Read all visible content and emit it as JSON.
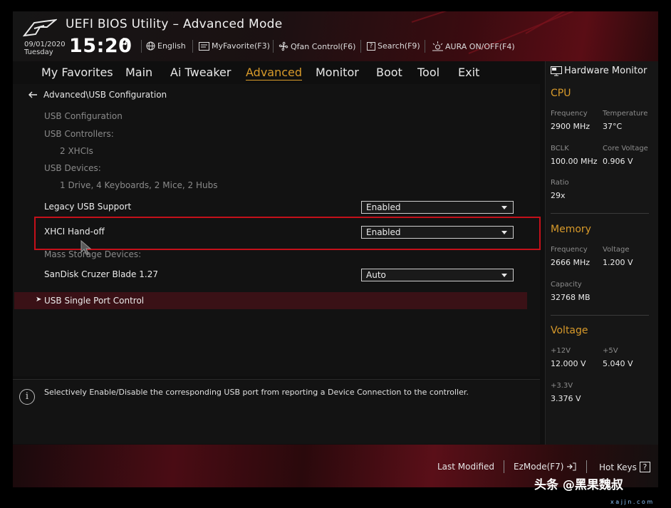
{
  "app": {
    "title": "UEFI BIOS Utility – Advanced Mode",
    "date": "09/01/2020",
    "weekday": "Tuesday",
    "time": "15:20"
  },
  "toolbar": {
    "language": "English",
    "myfavorite": "MyFavorite(F3)",
    "qfan": "Qfan Control(F6)",
    "search": "Search(F9)",
    "aura": "AURA ON/OFF(F4)"
  },
  "nav": {
    "tabs": [
      "My Favorites",
      "Main",
      "Ai Tweaker",
      "Advanced",
      "Monitor",
      "Boot",
      "Tool",
      "Exit"
    ],
    "active": "Advanced"
  },
  "main": {
    "breadcrumb": "Advanced\\USB Configuration",
    "usb_configuration": "USB Configuration",
    "usb_controllers_label": "USB Controllers:",
    "usb_controllers_value": "2 XHCIs",
    "usb_devices_label": "USB Devices:",
    "usb_devices_value": "1 Drive, 4 Keyboards, 2 Mice, 2 Hubs",
    "legacy_usb_label": "Legacy USB Support",
    "legacy_usb_value": "Enabled",
    "xhci_label": "XHCI Hand-off",
    "xhci_value": "Enabled",
    "mass_storage_label": "Mass Storage Devices:",
    "sandisk_label": "SanDisk Cruzer Blade 1.27",
    "sandisk_value": "Auto",
    "single_port_label": "USB Single Port Control"
  },
  "help": {
    "text": "Selectively Enable/Disable the corresponding USB port from reporting a Device Connection to the controller."
  },
  "hardware_monitor": {
    "title": "Hardware Monitor",
    "cpu": {
      "title": "CPU",
      "frequency_label": "Frequency",
      "frequency": "2900 MHz",
      "temperature_label": "Temperature",
      "temperature": "37°C",
      "bclk_label": "BCLK",
      "bclk": "100.00 MHz",
      "core_voltage_label": "Core Voltage",
      "core_voltage": "0.906 V",
      "ratio_label": "Ratio",
      "ratio": "29x"
    },
    "memory": {
      "title": "Memory",
      "frequency_label": "Frequency",
      "frequency": "2666 MHz",
      "voltage_label": "Voltage",
      "voltage": "1.200 V",
      "capacity_label": "Capacity",
      "capacity": "32768 MB"
    },
    "voltage": {
      "title": "Voltage",
      "v12_label": "+12V",
      "v12": "12.000 V",
      "v5_label": "+5V",
      "v5": "5.040 V",
      "v33_label": "+3.3V",
      "v33": "3.376 V"
    }
  },
  "footer": {
    "last_modified": "Last Modified",
    "ezmode": "EzMode(F7)",
    "hotkeys": "Hot Keys",
    "hotkeys_key": "?"
  },
  "watermark": {
    "text": "头条 @黑果魏叔",
    "site": "x a j j n . c o m"
  },
  "colors": {
    "accent": "#d89a2a",
    "highlight_box": "#c4101a",
    "selected_row": "#3a1116"
  }
}
